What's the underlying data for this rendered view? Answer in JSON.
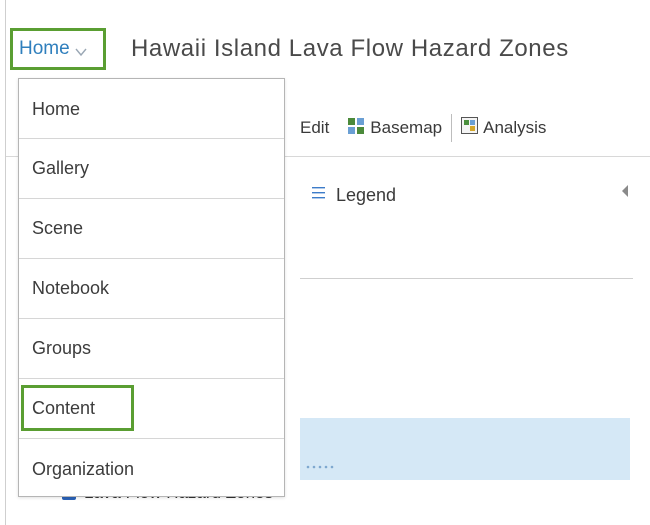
{
  "header": {
    "nav_label": "Home",
    "map_title": "Hawaii Island Lava Flow Hazard Zones"
  },
  "toolbar": {
    "edit_label": "Edit",
    "basemap_label": "Basemap",
    "analysis_label": "Analysis"
  },
  "pane": {
    "legend_label": "Legend",
    "layer_label": "Lava Flow Hazard Zones"
  },
  "menu": {
    "items": [
      {
        "label": "Home"
      },
      {
        "label": "Gallery"
      },
      {
        "label": "Scene"
      },
      {
        "label": "Notebook"
      },
      {
        "label": "Groups"
      },
      {
        "label": "Content",
        "highlighted": true
      },
      {
        "label": "Organization"
      }
    ]
  },
  "colors": {
    "highlight_border": "#5a9e32",
    "link_blue": "#2f7fbd",
    "selected_row": "#d5e8f6"
  }
}
